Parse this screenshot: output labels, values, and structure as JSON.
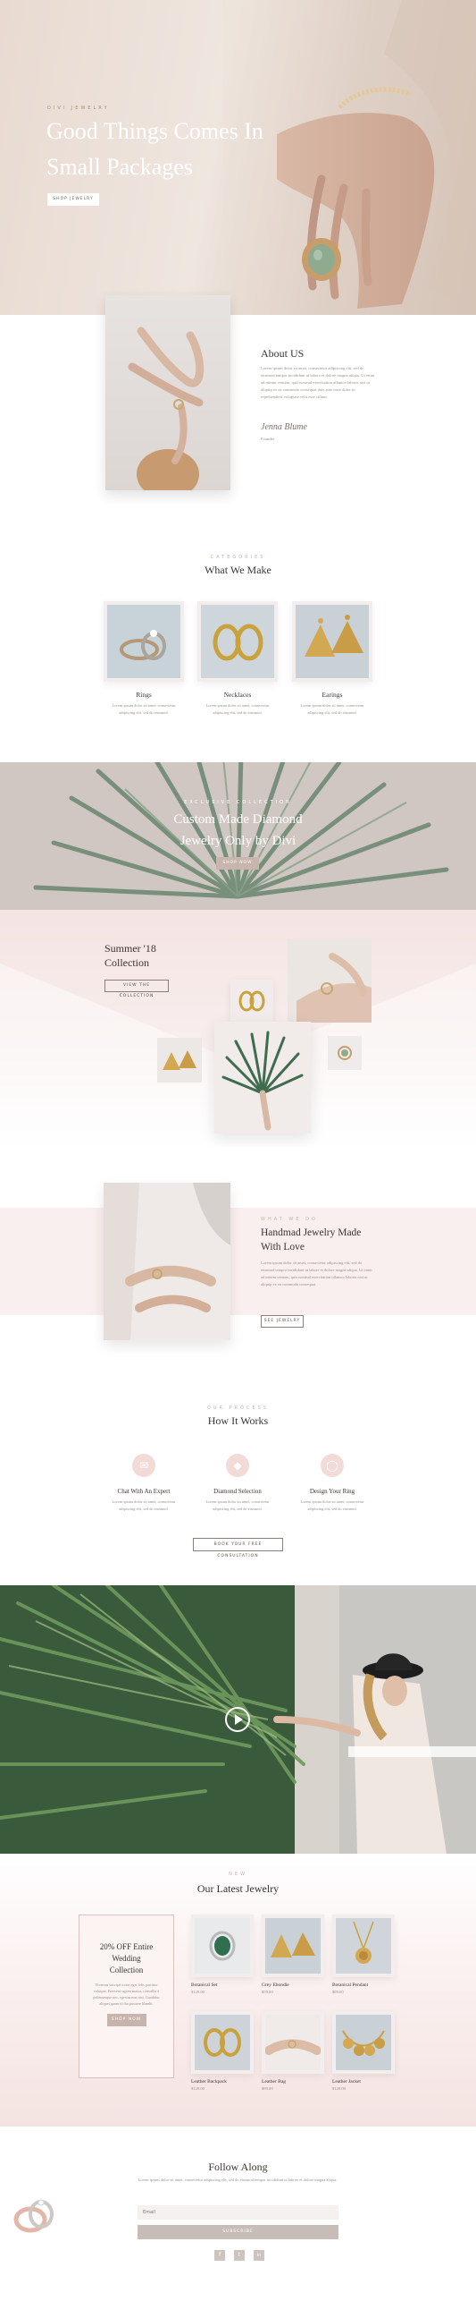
{
  "hero": {
    "eyebrow": "DIVI JEWELRY",
    "title_line1": "Good Things Comes In",
    "title_line2": "Small Packages",
    "button": "SHOP JEWELRY"
  },
  "about": {
    "heading": "About US",
    "body": "Lorem ipsum dolor sit amet, consectetur adipiscing elit, sed do eiusmod tempor incididunt ut labore et dolore magna aliqua. Ut enim ad minim veniam, quis nostrud exercitation ullamco laboris nisi ut aliquip ex ea commodo consequat duis aute irure dolor in reprehenderit voluptate velit esse cillum.",
    "signature": "Jenna Blume",
    "role": "Founder"
  },
  "what_we_make": {
    "eyebrow": "CATEGORIES",
    "heading": "What We Make",
    "items": [
      {
        "title": "Rings",
        "desc": "Lorem ipsum dolor sit amet, consectetur adipiscing elit, sed do eiusmod."
      },
      {
        "title": "Necklaces",
        "desc": "Lorem ipsum dolor sit amet, consectetur adipiscing elit, sed do eiusmod."
      },
      {
        "title": "Earings",
        "desc": "Lorem ipsum dolor sit amet, consectetur adipiscing elit, sed do eiusmod."
      }
    ]
  },
  "diamond": {
    "eyebrow": "EXCLUSIVE COLLECTION",
    "line1": "Custom Made Diamond",
    "line2": "Jewelry Only by Divi",
    "button": "SHOP NOW"
  },
  "summer": {
    "line1": "Summer '18",
    "line2": "Collection",
    "button": "VIEW THE COLLECTION"
  },
  "handmade": {
    "eyebrow": "WHAT WE DO",
    "line1": "Handmad Jewelry Made",
    "line2": "With Love",
    "body": "Lorem ipsum dolor sit amet, consectetur adipiscing elit, sed do eiusmod tempor incididunt ut labore et dolore magna aliqua. Ut enim ad minim veniam, quis nostrud exercitation ullamco laboris nisi ut aliquip ex ea commodo consequat.",
    "button": "SEE JEWELRY"
  },
  "how_it_works": {
    "eyebrow": "OUR PROCESS",
    "heading": "How It Works",
    "steps": [
      {
        "icon": "chat-icon",
        "title": "Chat With An Expert",
        "desc": "Lorem ipsum dolor sit amet, consectetur adipiscing elit, sed do eiusmod."
      },
      {
        "icon": "diamond-icon",
        "title": "Diamond Selection",
        "desc": "Lorem ipsum dolor sit amet, consectetur adipiscing elit, sed do eiusmod."
      },
      {
        "icon": "ring-icon",
        "title": "Design Your Ring",
        "desc": "Lorem ipsum dolor sit amet, consectetur adipiscing elit, sed do eiusmod."
      }
    ],
    "button": "BOOK YOUR FREE CONSULTATION"
  },
  "video": {
    "play_icon": "play-icon"
  },
  "latest": {
    "eyebrow": "NEW",
    "heading": "Our Latest Jewelry",
    "promo": {
      "line1": "20% OFF Entire",
      "line2": "Wedding",
      "line3": "Collection",
      "body": "Vivamus suscipit tortor eget felis porttitor volutpat. Praesent sapien massa, convallis a pellentesque nec, egestas non nisi. Curabitur aliquet quam id dui posuere blandit.",
      "button": "SHOP NOW"
    },
    "products": [
      {
        "name": "Botanical Set",
        "price": "$129.00"
      },
      {
        "name": "Grey Ebondie",
        "price": "$59.00"
      },
      {
        "name": "Botanical Pendant",
        "price": "$89.00"
      },
      {
        "name": "Leather Backpack",
        "price": "$120.00"
      },
      {
        "name": "Leather Bag",
        "price": "$89.00"
      },
      {
        "name": "Leather Jacket",
        "price": "$120.00"
      }
    ]
  },
  "follow": {
    "heading": "Follow Along",
    "body": "Lorem ipsum dolor sit amet, consectetur adipiscing elit, sed do eiusmod tempor incididunt ut labore et dolore magna aliqua.",
    "email_placeholder": "Email",
    "button": "SUBSCRIBE",
    "social": [
      "facebook-icon",
      "twitter-icon",
      "instagram-icon"
    ],
    "social_labels": [
      "f",
      "t",
      "in"
    ]
  }
}
